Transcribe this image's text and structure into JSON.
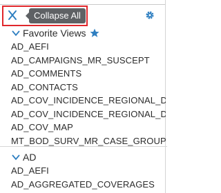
{
  "toolbar": {
    "tooltip": "Collapse All",
    "collapse_icon": "collapse-x-icon",
    "settings_icon": "gear-icon",
    "accent_color": "#2f7fc1"
  },
  "favorites": {
    "title": "Favorite Views",
    "star_icon": "star-icon",
    "items": [
      "AD_AEFI",
      "AD_CAMPAIGNS_MR_SUSCEPT",
      "AD_COMMENTS",
      "AD_CONTACTS",
      "AD_COV_INCIDENCE_REGIONAL_DIME",
      "AD_COV_INCIDENCE_REGIONAL_DIMY",
      "AD_COV_MAP",
      "MT_BOD_SURV_MR_CASE_GROUPED"
    ]
  },
  "ad": {
    "title": "AD",
    "items": [
      "AD_AEFI",
      "AD_AGGREGATED_COVERAGES"
    ]
  }
}
